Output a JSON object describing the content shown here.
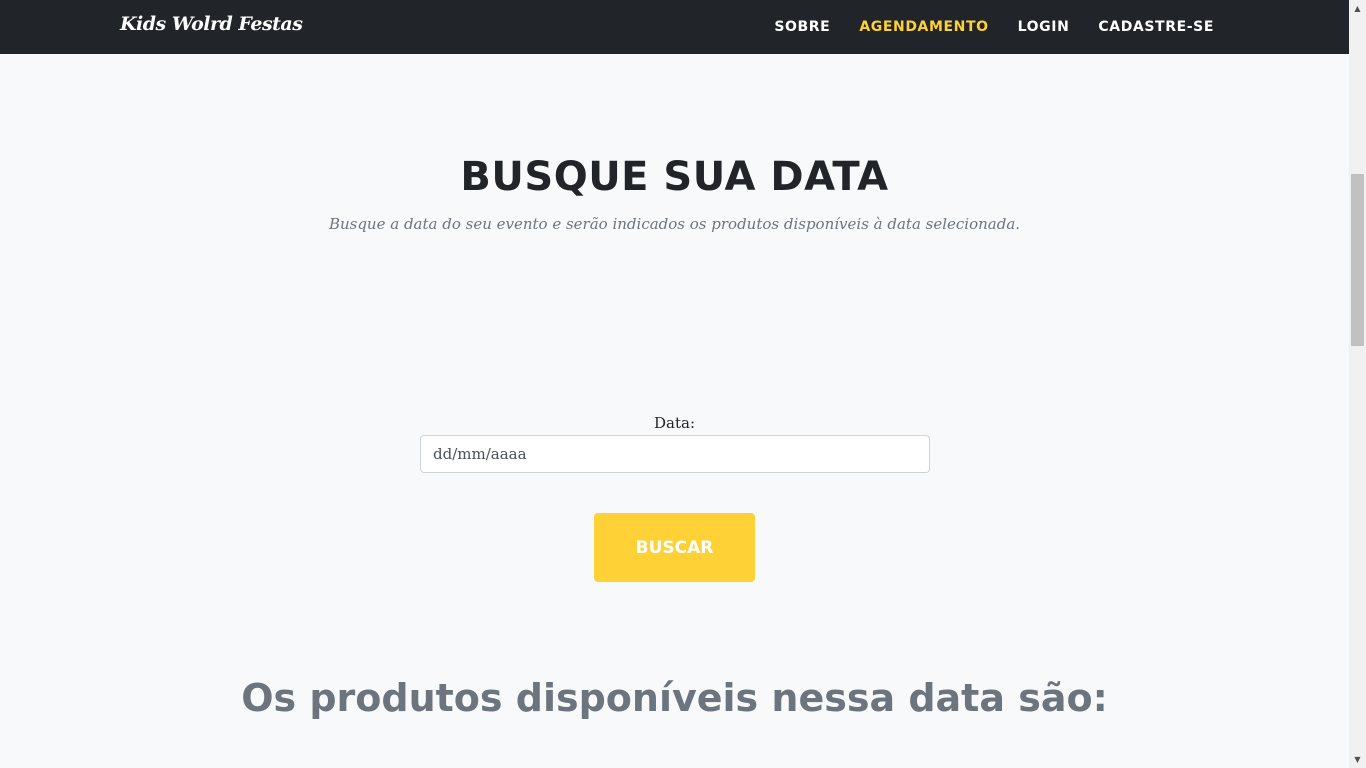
{
  "navbar": {
    "brand": "Kids Wolrd Festas",
    "items": [
      {
        "label": "SOBRE",
        "active": false
      },
      {
        "label": "AGENDAMENTO",
        "active": true
      },
      {
        "label": "LOGIN",
        "active": false
      },
      {
        "label": "CADASTRE-SE",
        "active": false
      }
    ]
  },
  "search_section": {
    "title": "BUSQUE SUA DATA",
    "subtitle": "Busque a data do seu evento e serão indicados os produtos disponíveis à data selecionada.",
    "date_label": "Data:",
    "date_placeholder": "dd/mm/aaaa",
    "button_label": "BUSCAR"
  },
  "products_section": {
    "title": "Os produtos disponíveis nessa data são:"
  },
  "colors": {
    "navbar_bg": "#212529",
    "accent": "#fed136",
    "page_bg": "#f8f9fa",
    "muted_text": "#6c757d"
  },
  "icons": {
    "scroll_up": "triangle-up-icon",
    "scroll_down": "triangle-down-icon"
  }
}
